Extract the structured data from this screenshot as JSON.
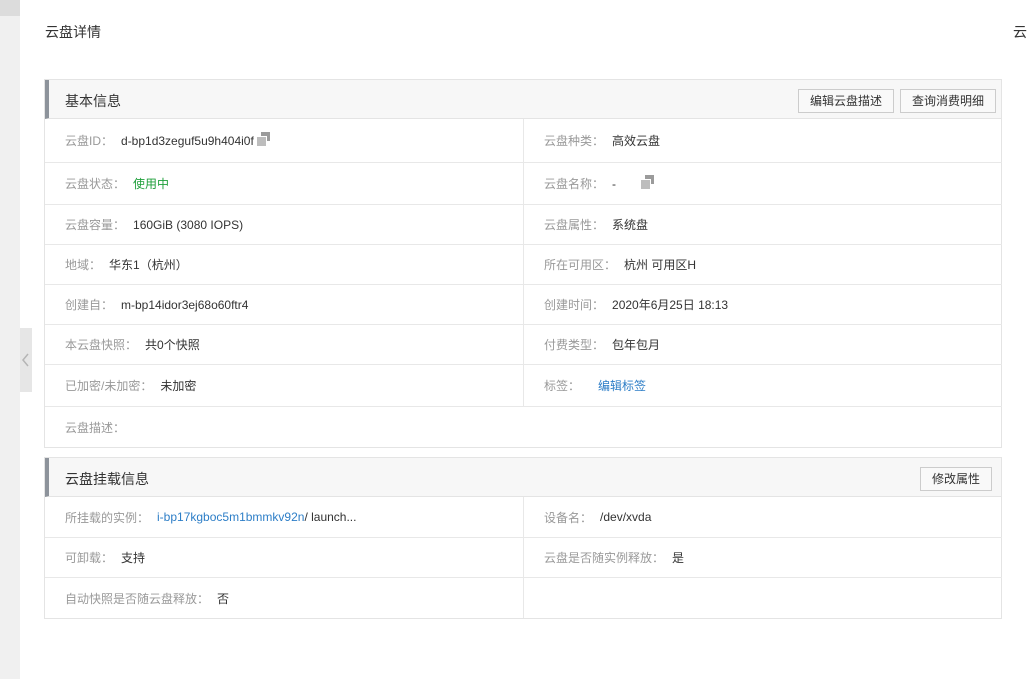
{
  "page": {
    "title": "云盘详情",
    "edge_text": "云"
  },
  "basic_info": {
    "title": "基本信息",
    "buttons": {
      "edit_desc": "编辑云盘描述",
      "query_billing": "查询消费明细"
    },
    "fields": {
      "disk_id": {
        "label": "云盘ID：",
        "value": "d-bp1d3zeguf5u9h404i0f"
      },
      "disk_type": {
        "label": "云盘种类：",
        "value": "高效云盘"
      },
      "status": {
        "label": "云盘状态：",
        "value": "使用中"
      },
      "disk_name": {
        "label": "云盘名称：",
        "value": "-"
      },
      "capacity": {
        "label": "云盘容量：",
        "value": "160GiB (3080 IOPS)"
      },
      "attribute": {
        "label": "云盘属性：",
        "value": "系统盘"
      },
      "region": {
        "label": "地域：",
        "value": "华东1（杭州）"
      },
      "zone": {
        "label": "所在可用区：",
        "value": "杭州 可用区H"
      },
      "created_from": {
        "label": "创建自：",
        "value": "m-bp14idor3ej68o60ftr4"
      },
      "created_time": {
        "label": "创建时间：",
        "value": "2020年6月25日 18:13"
      },
      "snapshots": {
        "label": "本云盘快照：",
        "value": "共0个快照"
      },
      "billing_type": {
        "label": "付费类型：",
        "value": "包年包月"
      },
      "encryption": {
        "label": "已加密/未加密：",
        "value": "未加密"
      },
      "tags": {
        "label": "标签：",
        "value": "编辑标签"
      },
      "description": {
        "label": "云盘描述：",
        "value": ""
      }
    }
  },
  "mount_info": {
    "title": "云盘挂载信息",
    "buttons": {
      "modify_attr": "修改属性"
    },
    "fields": {
      "instance": {
        "label": "所挂载的实例：",
        "instance_id": "i-bp17kgboc5m1bmmkv92n",
        "instance_name": " / launch..."
      },
      "device": {
        "label": "设备名：",
        "value": "/dev/xvda"
      },
      "detachable": {
        "label": "可卸载：",
        "value": "支持"
      },
      "release_with_instance": {
        "label": "云盘是否随实例释放：",
        "value": "是"
      },
      "snapshot_release": {
        "label": "自动快照是否随云盘释放：",
        "value": "否"
      }
    }
  },
  "colors": {
    "status_green": "#1e9f3a",
    "link_blue": "#2d7ec7",
    "header_accent": "#8d939b"
  }
}
